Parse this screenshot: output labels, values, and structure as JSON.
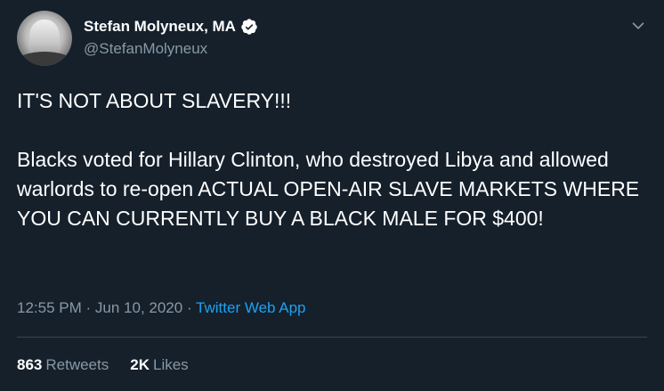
{
  "tweet": {
    "author": {
      "display_name": "Stefan Molyneux, MA",
      "handle": "@StefanMolyneux",
      "verified": true
    },
    "text_lines": [
      "IT'S NOT ABOUT SLAVERY!!!",
      "Blacks voted for Hillary Clinton, who destroyed Libya and allowed warlords to re-open ACTUAL OPEN-AIR SLAVE MARKETS WHERE YOU CAN CURRENTLY BUY A BLACK MALE FOR $400!"
    ],
    "time": "12:55 PM",
    "date": "Jun 10, 2020",
    "separator": "·",
    "source": "Twitter Web App",
    "retweets_count": "863",
    "retweets_label": "Retweets",
    "likes_count": "2K",
    "likes_label": "Likes"
  },
  "colors": {
    "background": "#15202b",
    "text": "#ffffff",
    "secondary": "#8899a6",
    "link": "#1da1f2",
    "divider": "#38444d"
  },
  "icons": {
    "verified": "verified-badge-icon",
    "caret": "chevron-down-icon"
  }
}
